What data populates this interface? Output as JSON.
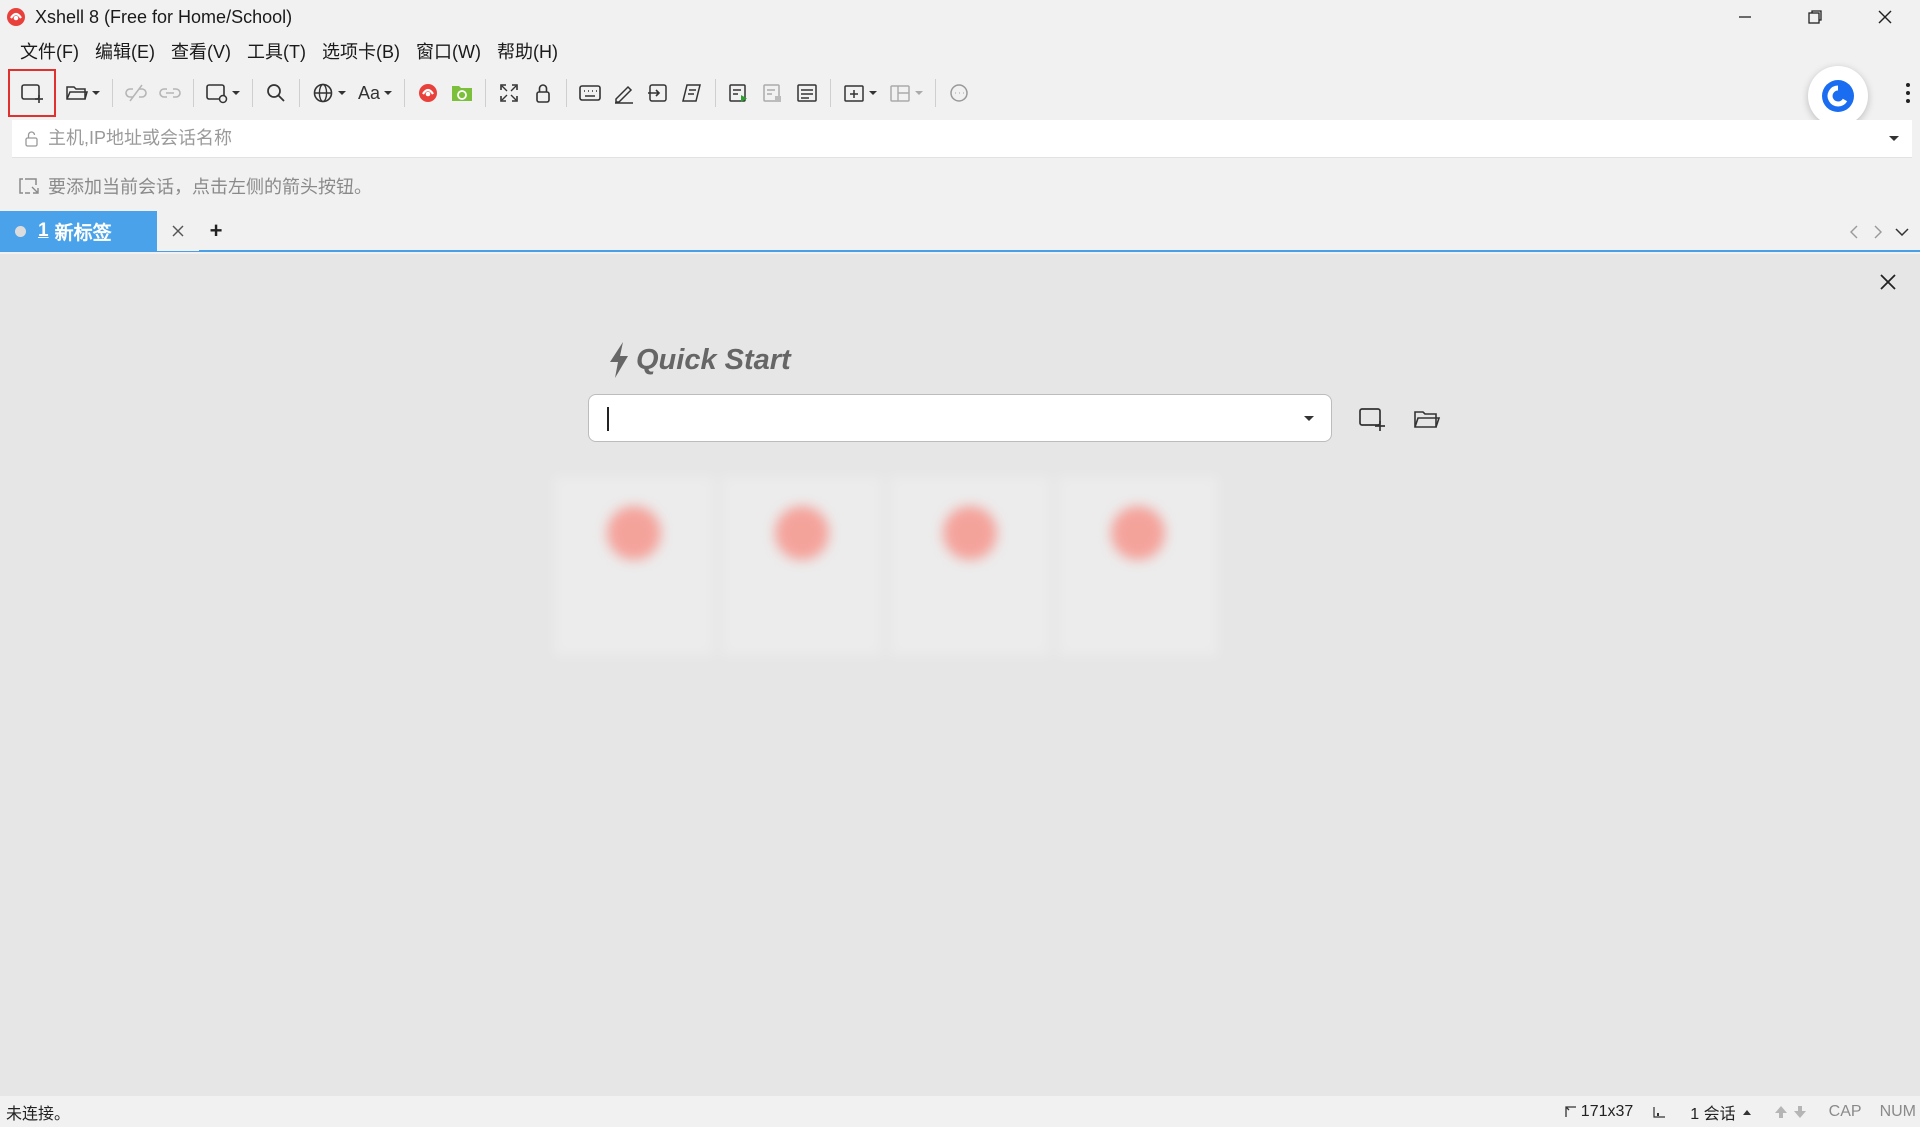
{
  "window": {
    "title": "Xshell 8 (Free for Home/School)"
  },
  "menu": [
    "文件(F)",
    "编辑(E)",
    "查看(V)",
    "工具(T)",
    "选项卡(B)",
    "窗口(W)",
    "帮助(H)"
  ],
  "toolbar": {
    "font_label": "Aa"
  },
  "address": {
    "placeholder": "主机,IP地址或会话名称",
    "value": ""
  },
  "hint": {
    "text": "要添加当前会话，点击左侧的箭头按钮。"
  },
  "tabs": {
    "active": {
      "number": "1",
      "label": "新标签"
    },
    "add_label": "+"
  },
  "quick_start": {
    "title": "Quick Start",
    "input_value": "",
    "recent_sessions": [
      {
        "name": ""
      },
      {
        "name": ""
      },
      {
        "name": ""
      },
      {
        "name": ""
      }
    ]
  },
  "status": {
    "left": "未连接。",
    "size": "171x37",
    "sessions": "1 会话",
    "cap": "CAP",
    "num": "NUM"
  },
  "colors": {
    "accent": "#4aa3ea",
    "highlight_border": "#e0312e",
    "brand": "#e8413c"
  }
}
